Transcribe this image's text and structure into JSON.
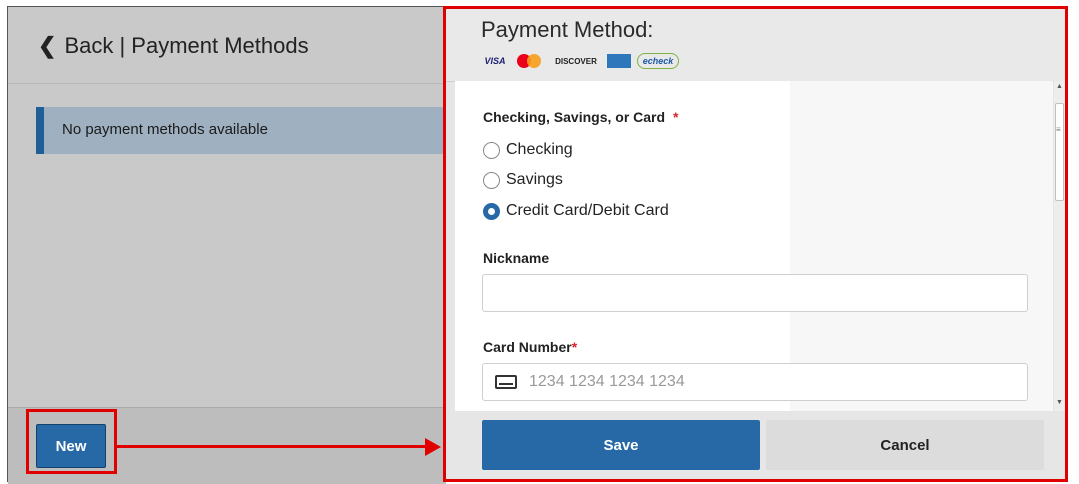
{
  "left_panel": {
    "back_label": "Back | Payment Methods",
    "notice": "No payment methods available",
    "new_button": "New"
  },
  "right_panel": {
    "title": "Payment Method:",
    "card_logos": [
      {
        "name": "visa",
        "label": "VISA"
      },
      {
        "name": "mastercard",
        "label": ""
      },
      {
        "name": "discover",
        "label": "DISCOVER"
      },
      {
        "name": "amex",
        "label": ""
      },
      {
        "name": "echeck",
        "label": "echeck"
      }
    ],
    "type_label": "Checking, Savings, or Card",
    "required_mark": "*",
    "options": [
      {
        "label": "Checking",
        "checked": false
      },
      {
        "label": "Savings",
        "checked": false
      },
      {
        "label": "Credit Card/Debit Card",
        "checked": true
      }
    ],
    "nickname_label": "Nickname",
    "nickname_value": "",
    "card_number_label": "Card Number",
    "card_number_placeholder": "1234 1234 1234 1234",
    "save_button": "Save",
    "cancel_button": "Cancel"
  },
  "colors": {
    "primary": "#2769a7",
    "highlight": "#e00000",
    "required": "#d9232e"
  }
}
